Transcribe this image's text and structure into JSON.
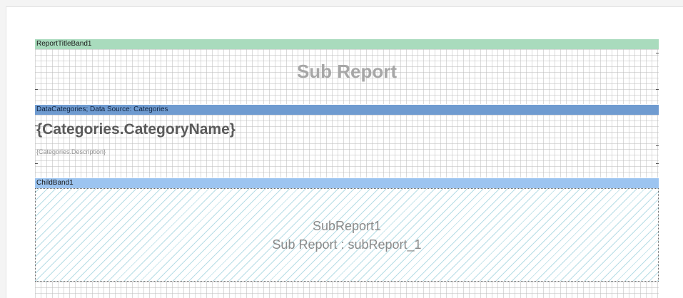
{
  "report_title_band": {
    "label": "ReportTitleBand1",
    "title_text": "Sub Report"
  },
  "data_band": {
    "label": "DataCategories; Data Source: Categories",
    "category_name_field": "{Categories.CategoryName}",
    "description_field": "{Categories.Description}"
  },
  "child_band": {
    "label": "ChildBand1",
    "subreport_name": "SubReport1",
    "subreport_caption": "Sub Report : subReport_1"
  },
  "colors": {
    "title_band": "#a9dbbd",
    "data_band": "#6f9bd0",
    "child_band": "#9cc4f0",
    "hatch": "#b7dde6"
  }
}
